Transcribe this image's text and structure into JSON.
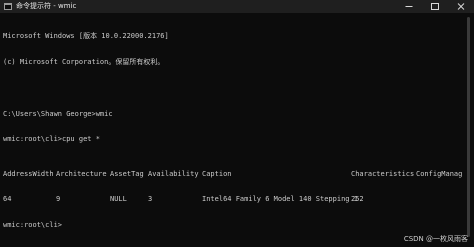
{
  "window": {
    "title": "命令提示符 - wmic",
    "controls": {
      "minimize": "—",
      "maximize": "☐",
      "close": "✕"
    }
  },
  "console": {
    "lines": [
      "Microsoft Windows [版本 10.0.22000.2176]",
      "(c) Microsoft Corporation。保留所有权利。",
      "",
      "C:\\Users\\Shawn George>wmic",
      "wmic:root\\cli>cpu get *"
    ],
    "table": {
      "headers": [
        "AddressWidth",
        "Architecture",
        "AssetTag",
        "Availability",
        "Caption",
        "Characteristics",
        "ConfigManage"
      ],
      "row": [
        "64",
        "9",
        "NULL",
        "3",
        "Intel64 Family 6 Model 140 Stepping 1",
        "252",
        ""
      ]
    },
    "prompt": "wmic:root\\cli>"
  },
  "watermark": "CSDN @一枚风雨客"
}
